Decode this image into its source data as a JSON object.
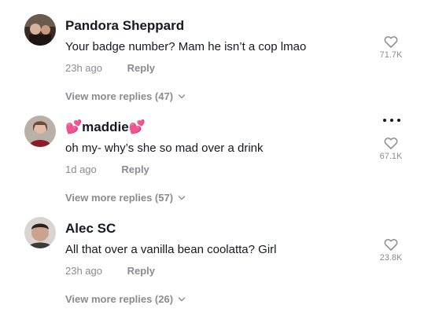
{
  "comments": [
    {
      "username": "Pandora Sheppard",
      "text": "Your badge number? Mam he isn’t a cop lmao",
      "time": "23h ago",
      "reply_label": "Reply",
      "like_count": "71.7K",
      "view_more": "View more replies (47)"
    },
    {
      "username_prefix": "💕",
      "username": "maddie",
      "username_suffix": "💕",
      "text": "oh my- why’s she so mad over a drink",
      "time": "1d ago",
      "reply_label": "Reply",
      "like_count": "67.1K",
      "view_more": "View more replies (57)"
    },
    {
      "username": "Alec SC",
      "text": "All that over a vanilla bean coolatta? Girl",
      "time": "23h ago",
      "reply_label": "Reply",
      "like_count": "23.8K",
      "view_more": "View more replies (26)"
    }
  ],
  "icons": {
    "like": "heart-outline-icon",
    "more": "more-horizontal-icon",
    "expand": "chevron-down-icon"
  },
  "colors": {
    "primary_text": "#161823",
    "secondary_text": "#8a8b91"
  }
}
